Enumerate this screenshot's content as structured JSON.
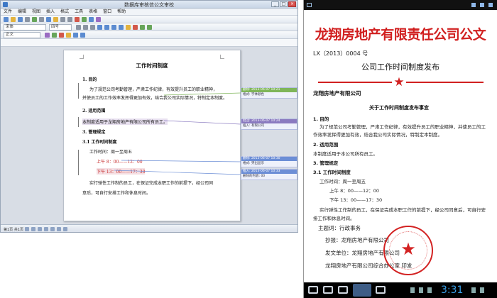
{
  "editor": {
    "window_title": "数据库审核信公文审校",
    "window_buttons": [
      "_",
      "□",
      "×"
    ],
    "menu": [
      "文件",
      "编辑",
      "视图",
      "插入",
      "格式",
      "工具",
      "表格",
      "窗口",
      "帮助"
    ],
    "font_combo": "宋体",
    "size_combo": "四号",
    "style_combo": "正文",
    "document": {
      "title": "工作时间制度",
      "lines": [
        "1. 目的",
        "为了规范公司考勤管理，严肃工作纪律，有效提升员工的职业精神，",
        "并使员工的工作效率发挥得更加有效，结合我公司实际情况，特制定本制度。",
        "2. 适用范围",
        "本制度适用于龙翔房地产有限公司所有员工。",
        "3. 管理规定",
        "3.1 工作时间制度",
        "工作时间：周一至周五",
        "上午 8：00——12：00",
        "下午 13：00——17：30",
        "实行弹性工作制的员工，在保证完成本职工作的前提下，经公司同",
        "意后，可自行安排工作和休息时间。"
      ]
    },
    "balloons": [
      {
        "header": "删除: 2013-06-07 10:21",
        "body": "格式: 字体颜色"
      },
      {
        "header": "批注: 2013-06-07 10:24",
        "body": "插入: 有限公司"
      },
      {
        "header": "删除: 2013-06-07 10:30",
        "body": "格式: 突出显示"
      },
      {
        "header": "插入: 2013-06-07 10:33",
        "body": "删除的内容: 00"
      }
    ],
    "status": "第1页 共1页"
  },
  "tablet": {
    "org_title": "龙翔房地产有限责任公司公文",
    "doc_no": "LX（2013）0004 号",
    "announce": "公司工作时间制度发布",
    "company_name": "龙翔房地产有限公司",
    "notice_title": "关于工作时间制度发布事宜",
    "lines": [
      "1. 目的",
      "为了规范公司考勤管理，严肃工作纪律，有效提升员工的职业精神，并使员工的工",
      "作效率发挥得更加有效，结合我公司实际情况，特制定本制度。",
      "2. 适用范围",
      "本制度适用于本公司所有员工。",
      "3. 管理规定",
      "3.1 工作时间制度",
      "工作时间：周一至周五",
      "上午 8：00——12：00",
      "下午 13：00——17：30",
      "实行弹性工作制的员工，在保证完成本职工作的前提下，经公司同意后，可自行安",
      "排工作和休息时间。"
    ],
    "keywords_label": "主题词：行政事务",
    "cc_line": "抄报：龙翔房地产有限公司",
    "issuer_line": "发文单位：龙翔房地产有限公司",
    "footer_line": "龙翔房地产有限公司综合办公室        印发",
    "clock": "3:31"
  },
  "colors": {
    "accent_red": "#d12020",
    "tablet_clock": "#3aa0e8"
  }
}
